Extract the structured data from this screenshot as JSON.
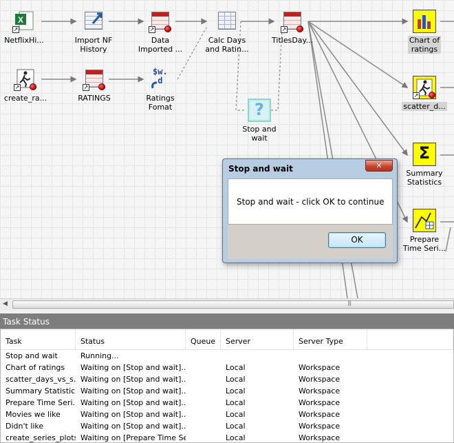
{
  "nodes": {
    "netflix_history": "NetflixHi...",
    "import_nf_history": "Import NF\nHistory",
    "data_imported": "Data\nImported ...",
    "calc_days": "Calc Days\nand Ratin...",
    "titles_days": "TitlesDay...",
    "chart_of_ratings": "Chart of\nratings",
    "create_ratings": "create_ra...",
    "ratings": "RATINGS",
    "ratings_format": "Ratings\nFomat",
    "stop_and_wait": "Stop and\nwait",
    "scatter": "scatter_d...",
    "summary_statistics": "Summary\nStatistics",
    "prepare_time_series": "Prepare\nTime Seri..."
  },
  "icons": {
    "ratings_format_glyph": "$w.\n.d",
    "summary_glyph": "Σ",
    "stop_wait_glyph": "?"
  },
  "dialog": {
    "title": "Stop and wait",
    "close_label": "✕",
    "message": "Stop and wait - click OK to continue",
    "ok_label": "OK"
  },
  "task_status": {
    "title": "Task Status",
    "columns": [
      "Task",
      "Status",
      "Queue",
      "Server",
      "Server Type"
    ],
    "rows": [
      [
        "Stop and wait",
        "Running...",
        "",
        "",
        ""
      ],
      [
        "Chart of ratings",
        "Waiting on [Stop and wait]...",
        "",
        "Local",
        "Workspace"
      ],
      [
        "scatter_days_vs_s...",
        "Waiting on [Stop and wait]...",
        "",
        "Local",
        "Workspace"
      ],
      [
        "Summary Statistics",
        "Waiting on [Stop and wait]...",
        "",
        "Local",
        "Workspace"
      ],
      [
        "Prepare Time Seri...",
        "Waiting on [Stop and wait]...",
        "",
        "Local",
        "Workspace"
      ],
      [
        "Movies we like",
        "Waiting on [Stop and wait]...",
        "",
        "Local",
        "Workspace"
      ],
      [
        "Didn't like",
        "Waiting on [Stop and wait]...",
        "",
        "Local",
        "Workspace"
      ],
      [
        "create_series_plots",
        "Waiting on [Prepare Time Se...",
        "",
        "Local",
        "Workspace"
      ]
    ]
  },
  "colors": {
    "canvas_bg": "#f5f5f5",
    "yellow_frame": "#ffff00",
    "panel_title_bg": "#7d7d7d",
    "dialog_frame": "#b8cde2"
  }
}
